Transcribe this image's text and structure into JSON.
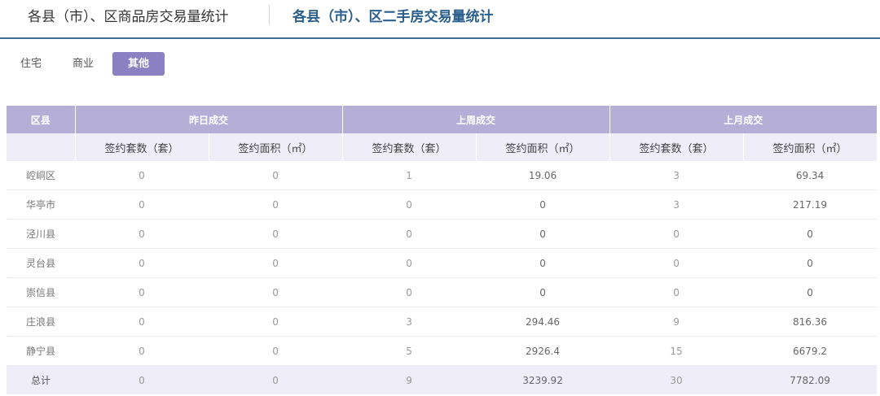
{
  "top_tabs": {
    "tab1": "各县（市）、区商品房交易量统计",
    "tab2": "各县（市）、区二手房交易量统计"
  },
  "sub_tabs": [
    "住宅",
    "商业",
    "其他"
  ],
  "table": {
    "header_groups": [
      "区县",
      "昨日成交",
      "上周成交",
      "上月成交"
    ],
    "sub_headers": [
      "签约套数（套）",
      "签约面积（㎡）",
      "签约套数（套）",
      "签约面积（㎡）",
      "签约套数（套）",
      "签约面积（㎡）"
    ],
    "rows": [
      {
        "district": "崆峒区",
        "values": [
          "0",
          "0",
          "1",
          "19.06",
          "3",
          "69.34"
        ]
      },
      {
        "district": "华亭市",
        "values": [
          "0",
          "0",
          "0",
          "0",
          "3",
          "217.19"
        ]
      },
      {
        "district": "泾川县",
        "values": [
          "0",
          "0",
          "0",
          "0",
          "0",
          "0"
        ]
      },
      {
        "district": "灵台县",
        "values": [
          "0",
          "0",
          "0",
          "0",
          "0",
          "0"
        ]
      },
      {
        "district": "崇信县",
        "values": [
          "0",
          "0",
          "0",
          "0",
          "0",
          "0"
        ]
      },
      {
        "district": "庄浪县",
        "values": [
          "0",
          "0",
          "3",
          "294.46",
          "9",
          "816.36"
        ]
      },
      {
        "district": "静宁县",
        "values": [
          "0",
          "0",
          "5",
          "2926.4",
          "15",
          "6679.2"
        ]
      },
      {
        "district": "总计",
        "values": [
          "0",
          "0",
          "9",
          "3239.92",
          "30",
          "7782.09"
        ]
      }
    ]
  },
  "colors": {
    "header_bg": "#b5afd7",
    "subheader_bg": "#efeef8",
    "active_tab_bg": "#8b80c1",
    "accent_line": "#3d6e9a",
    "active_title": "#2a5f8d"
  }
}
